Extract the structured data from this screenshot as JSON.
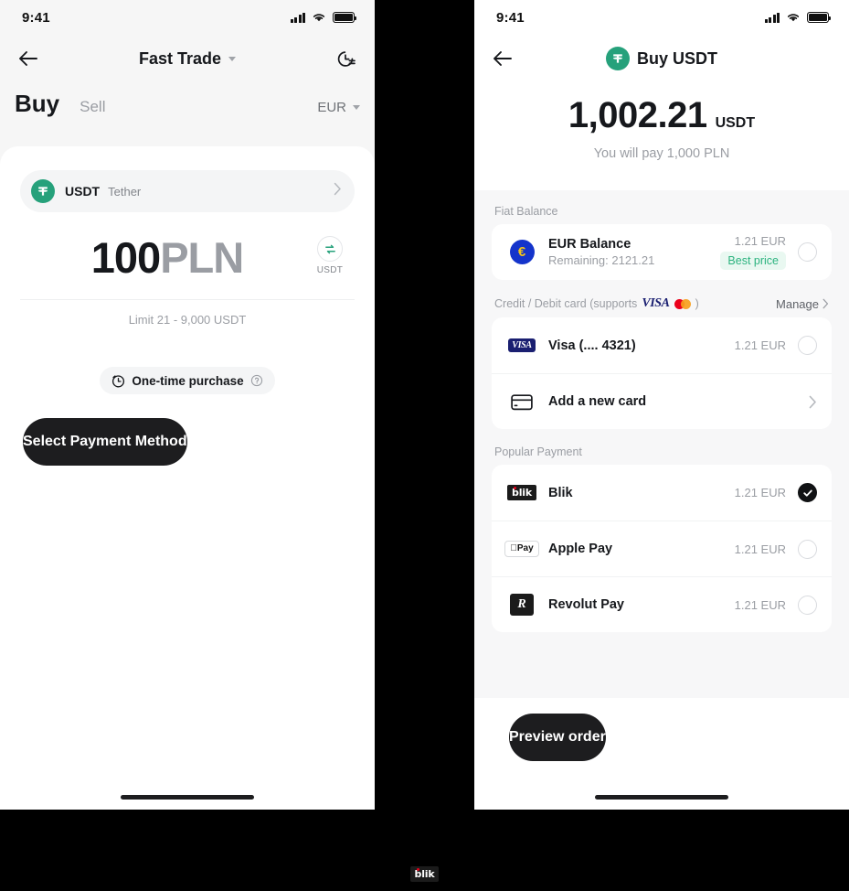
{
  "left": {
    "status": {
      "time": "9:41"
    },
    "nav": {
      "title": "Fast Trade",
      "back_icon": "arrow-left-icon",
      "history_icon": "clock-history-icon",
      "caret_icon": "chevron-down-icon"
    },
    "tabs": {
      "buy": "Buy",
      "sell": "Sell",
      "currency": "EUR"
    },
    "coin": {
      "symbol": "USDT",
      "name": "Tether",
      "logo": "tether-icon"
    },
    "amount": {
      "value": "100",
      "currency": "PLN",
      "swap_to": "USDT",
      "swap_icon": "swap-icon"
    },
    "limit": "Limit 21 - 9,000 USDT",
    "purchase_chip": {
      "label": "One-time purchase",
      "icon": "clock-icon",
      "help_icon": "question-circle-icon"
    },
    "cta": "Select Payment Method"
  },
  "right": {
    "status": {
      "time": "9:41"
    },
    "nav": {
      "title": "Buy USDT",
      "back_icon": "arrow-left-icon",
      "logo": "tether-icon"
    },
    "hero": {
      "amount": "1,002.21",
      "unit": "USDT",
      "subtitle": "You will pay 1,000 PLN"
    },
    "sections": [
      {
        "title": "Fiat Balance",
        "rows": [
          {
            "name": "EUR Balance",
            "sub": "Remaining: 2121.21",
            "price": "1.21 EUR",
            "badge": "Best price",
            "icon": "euro-coin-icon",
            "selected": false
          }
        ]
      },
      {
        "title": "Credit / Debit card (supports",
        "title_suffix": ")",
        "action": "Manage",
        "brands": [
          "visa-logo",
          "mastercard-logo"
        ],
        "rows": [
          {
            "name": "Visa (.... 4321)",
            "price": "1.21 EUR",
            "icon": "visa-card-icon",
            "selected": false
          },
          {
            "name": "Add a new card",
            "icon": "credit-card-icon",
            "chevron": true
          }
        ]
      },
      {
        "title": "Popular Payment",
        "rows": [
          {
            "name": "Blik",
            "price": "1.21 EUR",
            "icon": "blik-logo-icon",
            "selected": true
          },
          {
            "name": "Apple Pay",
            "price": "1.21 EUR",
            "icon": "apple-pay-icon",
            "selected": false
          },
          {
            "name": "Revolut Pay",
            "price": "1.21 EUR",
            "icon": "revolut-logo-icon",
            "selected": false
          }
        ]
      }
    ],
    "cta": "Preview order"
  },
  "footer_brand": {
    "label": "blik"
  },
  "colors": {
    "accent_green": "#26a17b",
    "best_price_text": "#2cb37f",
    "best_price_bg": "#e9f8f1",
    "cta_bg": "#1d1d1f",
    "visa_blue": "#1434cb",
    "page_bg": "#000000"
  }
}
